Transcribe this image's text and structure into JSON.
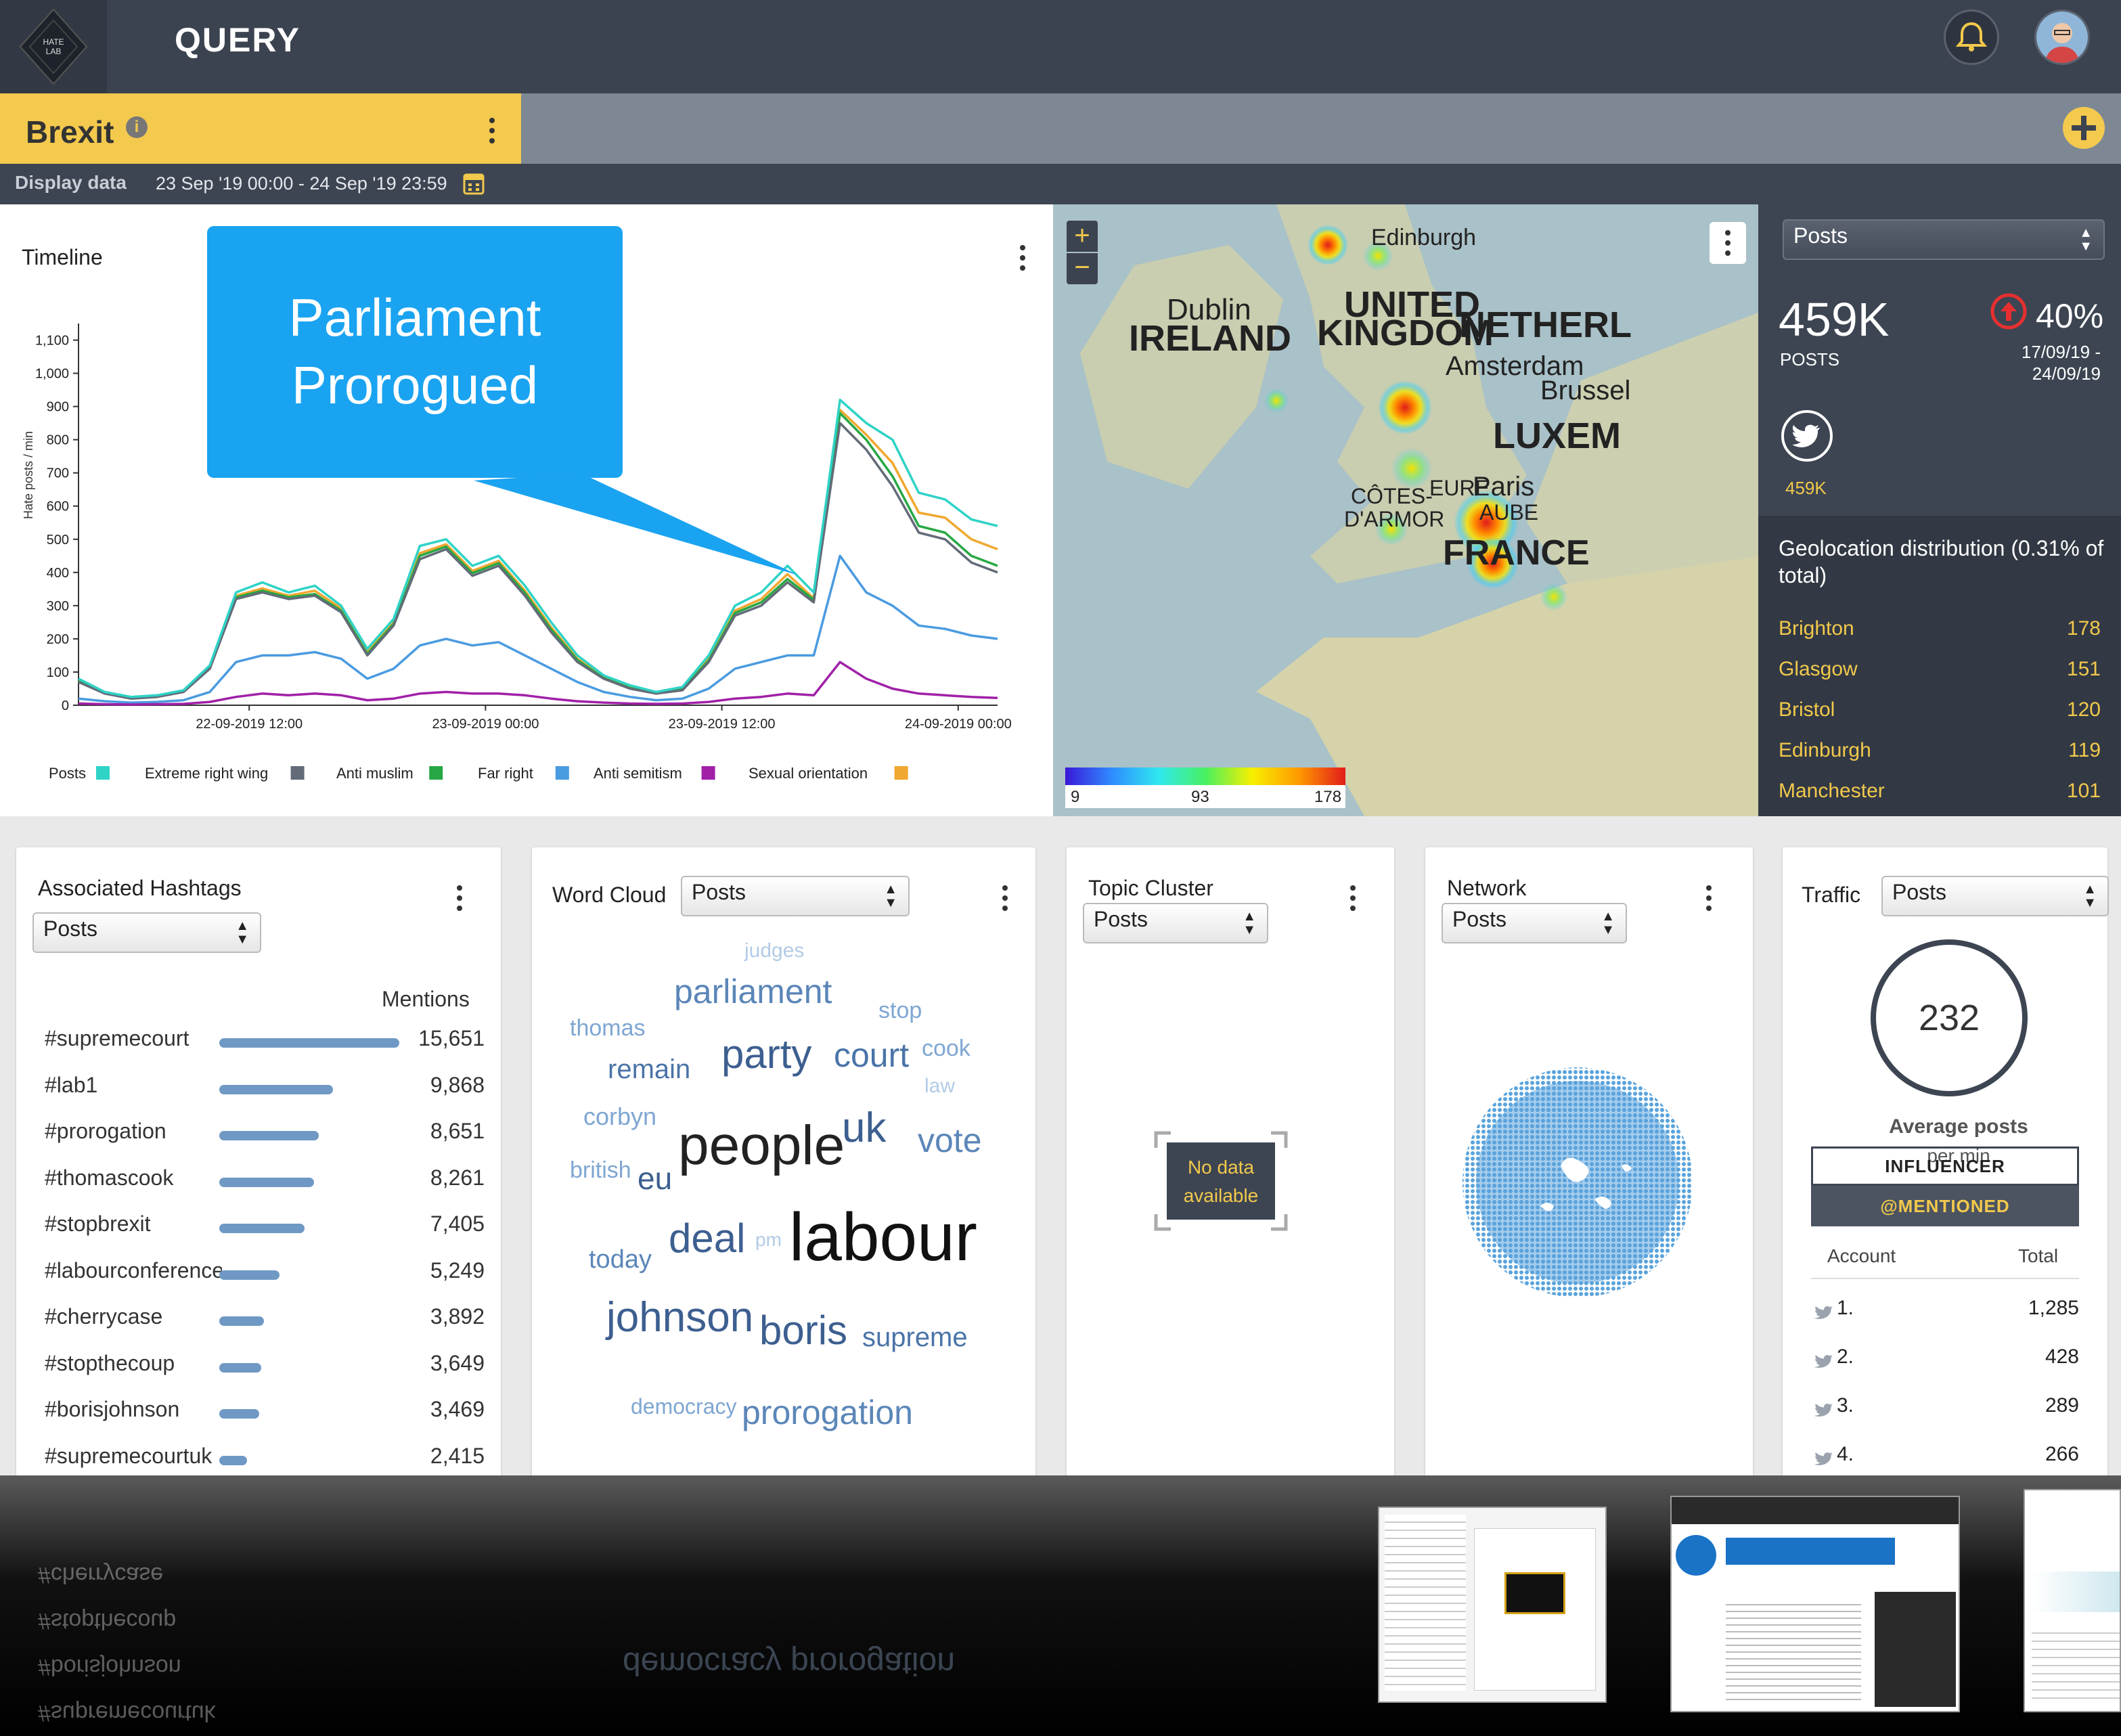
{
  "header": {
    "logo_text": "HATE LAB",
    "title": "QUERY",
    "bell_icon": "bell-icon",
    "avatar": "avatar"
  },
  "tab": {
    "label": "Brexit",
    "add_icon": "plus-icon"
  },
  "range": {
    "label": "Display data",
    "value": "23 Sep '19 00:00 - 24 Sep '19 23:59"
  },
  "timeline": {
    "title": "Timeline",
    "callout": [
      "Parliament",
      "Prorogued"
    ]
  },
  "chart_data": {
    "type": "line",
    "ylabel": "Hate posts / min",
    "ylim": [
      0,
      1150
    ],
    "yticks": [
      "0",
      "100",
      "200",
      "300",
      "400",
      "500",
      "600",
      "700",
      "800",
      "900",
      "1,000",
      "1,100"
    ],
    "xticks": [
      "22-09-2019 12:00",
      "23-09-2019 00:00",
      "23-09-2019 12:00",
      "24-09-2019 00:00"
    ],
    "x": [
      0,
      2,
      4,
      6,
      8,
      10,
      12,
      14,
      16,
      18,
      20,
      22,
      24,
      26,
      28,
      30,
      32,
      34,
      36,
      38,
      40,
      42,
      44,
      46,
      48,
      50,
      52,
      54,
      56,
      58,
      60,
      62,
      64,
      66,
      68,
      70
    ],
    "series": [
      {
        "name": "Posts",
        "color": "#2ed3c6",
        "values": [
          80,
          40,
          25,
          30,
          45,
          120,
          340,
          370,
          340,
          360,
          300,
          170,
          260,
          480,
          500,
          420,
          450,
          360,
          250,
          150,
          90,
          60,
          40,
          55,
          150,
          300,
          340,
          420,
          340,
          920,
          850,
          800,
          640,
          620,
          560,
          540
        ]
      },
      {
        "name": "Extreme right wing",
        "color": "#636b78",
        "values": [
          70,
          35,
          20,
          25,
          40,
          110,
          320,
          340,
          320,
          330,
          280,
          150,
          240,
          440,
          470,
          390,
          420,
          330,
          220,
          130,
          80,
          50,
          35,
          45,
          130,
          270,
          300,
          370,
          310,
          850,
          770,
          660,
          520,
          500,
          430,
          400
        ]
      },
      {
        "name": "Anti muslim",
        "color": "#27a844",
        "values": [
          72,
          36,
          22,
          27,
          42,
          112,
          325,
          345,
          325,
          335,
          285,
          155,
          245,
          450,
          478,
          398,
          428,
          338,
          228,
          136,
          82,
          52,
          37,
          48,
          135,
          278,
          310,
          380,
          318,
          880,
          800,
          690,
          540,
          520,
          450,
          420
        ]
      },
      {
        "name": "Far right",
        "color": "#4a9be0",
        "values": [
          20,
          12,
          8,
          10,
          15,
          40,
          130,
          150,
          150,
          160,
          140,
          80,
          110,
          180,
          200,
          180,
          190,
          150,
          110,
          70,
          40,
          25,
          15,
          20,
          50,
          110,
          130,
          150,
          150,
          450,
          340,
          300,
          240,
          230,
          210,
          200
        ]
      },
      {
        "name": "Anti semitism",
        "color": "#a020a8",
        "values": [
          5,
          3,
          2,
          3,
          4,
          10,
          25,
          35,
          30,
          35,
          30,
          15,
          20,
          35,
          40,
          35,
          35,
          30,
          20,
          12,
          8,
          5,
          4,
          5,
          10,
          20,
          25,
          35,
          30,
          130,
          80,
          50,
          35,
          30,
          25,
          22
        ]
      },
      {
        "name": "Sexual orientation",
        "color": "#f0a830",
        "values": [
          74,
          37,
          23,
          28,
          43,
          115,
          330,
          352,
          330,
          345,
          292,
          160,
          250,
          458,
          485,
          405,
          435,
          345,
          235,
          140,
          85,
          55,
          38,
          50,
          140,
          285,
          320,
          395,
          322,
          890,
          815,
          730,
          580,
          565,
          500,
          470
        ]
      }
    ]
  },
  "map": {
    "places": [
      "Edinburgh",
      "Dublin",
      "UNITED",
      "KINGDOM",
      "IRELAND",
      "NETHERL",
      "Amsterdam",
      "Brussel",
      "LUXEM",
      "Paris",
      "EURE",
      "AUBE",
      "CÔTES-",
      "D'ARMOR",
      "FRANCE"
    ],
    "zoom_in": "+",
    "zoom_out": "−",
    "scale": [
      "9",
      "93",
      "178"
    ]
  },
  "stats": {
    "select": "Posts",
    "total": "459K",
    "total_label": "POSTS",
    "change": "40%",
    "period": [
      "17/09/19 -",
      "24/09/19"
    ],
    "twitter_count": "459K",
    "geo_title": "Geolocation distribution (0.31% of total)",
    "cities": [
      {
        "name": "Brighton",
        "value": "178"
      },
      {
        "name": "Glasgow",
        "value": "151"
      },
      {
        "name": "Bristol",
        "value": "120"
      },
      {
        "name": "Edinburgh",
        "value": "119"
      },
      {
        "name": "Manchester",
        "value": "101"
      }
    ]
  },
  "hashtags": {
    "title": "Associated Hashtags",
    "select": "Posts",
    "col": "Mentions",
    "items": [
      {
        "tag": "#supremecourt",
        "value": "15,651",
        "count": 15651
      },
      {
        "tag": "#lab1",
        "value": "9,868",
        "count": 9868
      },
      {
        "tag": "#prorogation",
        "value": "8,651",
        "count": 8651
      },
      {
        "tag": "#thomascook",
        "value": "8,261",
        "count": 8261
      },
      {
        "tag": "#stopbrexit",
        "value": "7,405",
        "count": 7405
      },
      {
        "tag": "#labourconference",
        "value": "5,249",
        "count": 5249
      },
      {
        "tag": "#cherrycase",
        "value": "3,892",
        "count": 3892
      },
      {
        "tag": "#stopthecoup",
        "value": "3,649",
        "count": 3649
      },
      {
        "tag": "#borisjohnson",
        "value": "3,469",
        "count": 3469
      },
      {
        "tag": "#supremecourtuk",
        "value": "2,415",
        "count": 2415
      }
    ]
  },
  "wordcloud": {
    "title": "Word Cloud",
    "select": "Posts",
    "words": [
      "judges",
      "parliament",
      "stop",
      "thomas",
      "party",
      "court",
      "cook",
      "remain",
      "law",
      "corbyn",
      "uk",
      "vote",
      "people",
      "british",
      "eu",
      "deal",
      "pm",
      "labour",
      "today",
      "johnson",
      "boris",
      "supreme",
      "democracy",
      "prorogation"
    ]
  },
  "topic": {
    "title": "Topic Cluster",
    "select": "Posts",
    "empty": [
      "No data",
      "available"
    ]
  },
  "network": {
    "title": "Network",
    "select": "Posts"
  },
  "traffic": {
    "title": "Traffic",
    "select": "Posts",
    "avg": "232",
    "avg_label": "Average posts",
    "avg_sub": "per min",
    "tabs": [
      "INFLUENCER",
      "@MENTIONED"
    ],
    "cols": [
      "Account",
      "Total"
    ],
    "rows": [
      {
        "rank": "1.",
        "total": "1,285"
      },
      {
        "rank": "2.",
        "total": "428"
      },
      {
        "rank": "3.",
        "total": "289"
      },
      {
        "rank": "4.",
        "total": "266"
      }
    ]
  }
}
